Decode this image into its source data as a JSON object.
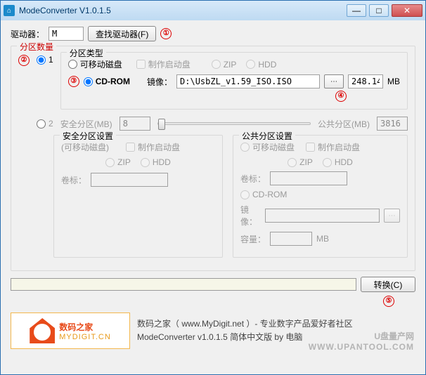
{
  "window": {
    "title": "ModeConverter V1.0.1.5"
  },
  "winctrl": {
    "min": "—",
    "max": "□",
    "close": "✕"
  },
  "driver": {
    "label": "驱动器：",
    "value": "M",
    "find_btn": "查找驱动器(F)"
  },
  "markers": {
    "m1": "①",
    "m2": "②",
    "m3": "③",
    "m4": "④",
    "m5": "⑤"
  },
  "partition_count": {
    "legend": "分区数量"
  },
  "opt1": {
    "num": "1",
    "type_legend": "分区类型",
    "removable": "可移动磁盘",
    "make_boot": "制作启动盘",
    "zip": "ZIP",
    "hdd": "HDD",
    "cdrom": "CD-ROM",
    "image_label": "镜像：",
    "image_path": "D:\\UsbZL_v1.59_ISO.ISO",
    "size": "248.14",
    "size_unit": "MB"
  },
  "opt2": {
    "num": "2",
    "safe_label": "安全分区(MB)",
    "safe_value": "8",
    "public_label": "公共分区(MB)",
    "public_value": "3816",
    "safe_settings": {
      "legend": "安全分区设置",
      "subtitle": "(可移动磁盘)",
      "make_boot": "制作启动盘",
      "zip": "ZIP",
      "hdd": "HDD",
      "vol_label": "卷标："
    },
    "public_settings": {
      "legend": "公共分区设置",
      "removable": "可移动磁盘",
      "make_boot": "制作启动盘",
      "zip": "ZIP",
      "hdd": "HDD",
      "vol_label": "卷标：",
      "cdrom": "CD-ROM",
      "image_label": "镜像：",
      "capacity_label": "容量：",
      "capacity_unit": "MB"
    }
  },
  "convert_btn": "转换(C)",
  "logo": {
    "brand": "数码之家",
    "url": "MYDIGIT.CN"
  },
  "credits": {
    "line1": "数码之家（ www.MyDigit.net ）- 专业数字产品爱好者社区",
    "line2": "ModeConverter v1.0.1.5 简体中文版 by 电脑"
  },
  "watermark": {
    "main": "U盘量产网",
    "sub": "WWW.UPANTOOL.COM"
  }
}
